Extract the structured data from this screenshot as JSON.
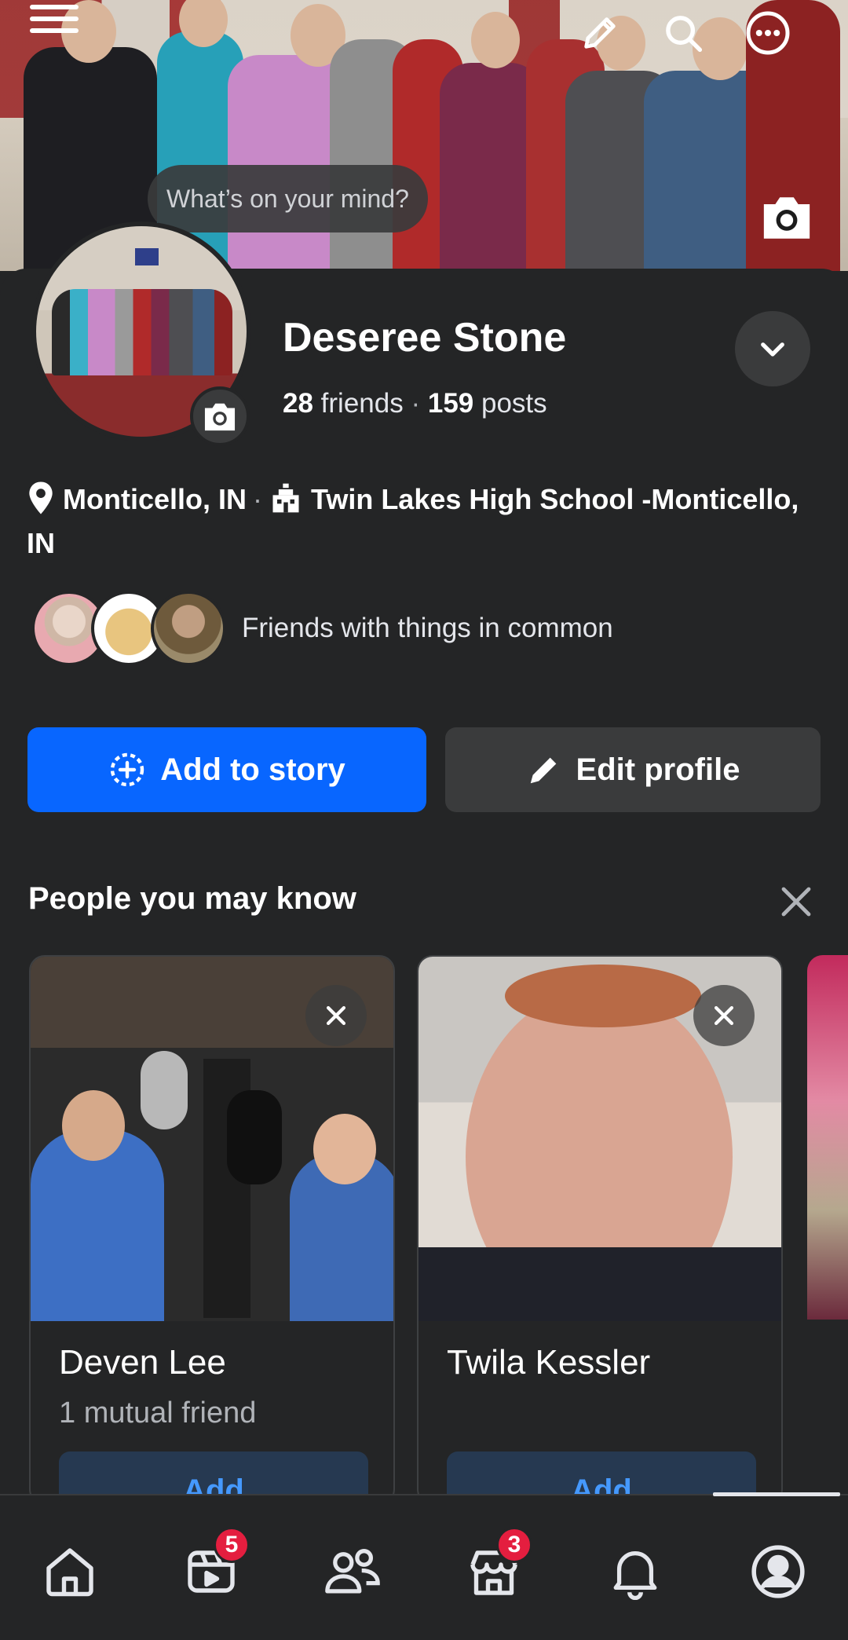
{
  "composer": {
    "placeholder": "What’s on your mind?"
  },
  "profile": {
    "name": "Deseree Stone",
    "friends_count": "28",
    "friends_label": "friends",
    "posts_count": "159",
    "posts_label": "posts",
    "location": "Monticello, IN",
    "school": "Twin Lakes High School -Monticello, IN",
    "mutual_text": "Friends with things in common"
  },
  "actions": {
    "add_story": "Add to story",
    "edit_profile": "Edit profile"
  },
  "pymk": {
    "title": "People you may know",
    "people": [
      {
        "name": "Deven Lee",
        "mutual": "1 mutual friend",
        "add": "Add"
      },
      {
        "name": "Twila Kessler",
        "mutual": "",
        "add": "Add"
      }
    ]
  },
  "nav": {
    "video_badge": "5",
    "marketplace_badge": "3"
  },
  "icons": [
    "menu-icon",
    "pencil-icon",
    "search-icon",
    "more-icon",
    "camera-icon",
    "chevron-down-icon",
    "location-pin-icon",
    "school-icon",
    "add-story-icon",
    "close-icon",
    "home-icon",
    "video-icon",
    "friends-icon",
    "marketplace-icon",
    "bell-icon",
    "profile-icon"
  ],
  "colors": {
    "accent": "#0866ff",
    "badge": "#e41e3f",
    "background": "#242526"
  }
}
